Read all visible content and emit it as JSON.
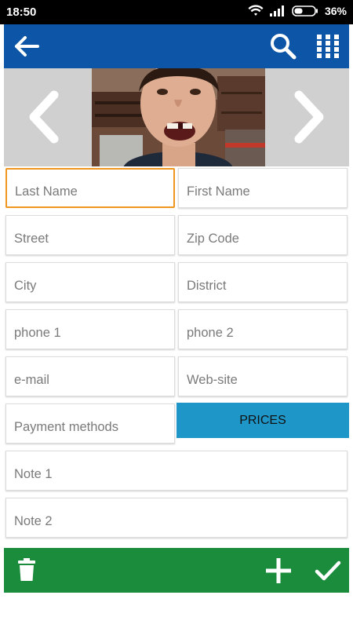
{
  "status_bar": {
    "time": "18:50",
    "battery_percent": "36%",
    "icons": [
      "wifi-icon",
      "signal-icon",
      "battery-icon"
    ]
  },
  "app_bar": {
    "color": "#0d55a6",
    "icons": [
      "back-arrow-icon",
      "search-icon",
      "grid-menu-icon"
    ]
  },
  "photo_strip": {
    "icons": [
      "chevron-left-icon",
      "chevron-right-icon"
    ]
  },
  "form": {
    "last_name": {
      "placeholder": "Last Name",
      "value": ""
    },
    "first_name": {
      "placeholder": "First Name",
      "value": ""
    },
    "street": {
      "placeholder": "Street",
      "value": ""
    },
    "zip_code": {
      "placeholder": "Zip Code",
      "value": ""
    },
    "city": {
      "placeholder": "City",
      "value": ""
    },
    "district": {
      "placeholder": "District",
      "value": ""
    },
    "phone1": {
      "placeholder": "phone 1",
      "value": ""
    },
    "phone2": {
      "placeholder": "phone 2",
      "value": ""
    },
    "email": {
      "placeholder": "e-mail",
      "value": ""
    },
    "website": {
      "placeholder": "Web-site",
      "value": ""
    },
    "payment_methods": {
      "placeholder": "Payment methods",
      "value": ""
    },
    "note1": {
      "placeholder": "Note 1",
      "value": ""
    },
    "note2": {
      "placeholder": "Note 2",
      "value": ""
    }
  },
  "prices_button": {
    "label": "PRICES",
    "color": "#1e96c8"
  },
  "bottom_bar": {
    "color": "#1a8c3c",
    "icons": [
      "trash-icon",
      "plus-icon",
      "checkmark-icon"
    ]
  },
  "colors": {
    "focus_border": "#f0961e"
  }
}
